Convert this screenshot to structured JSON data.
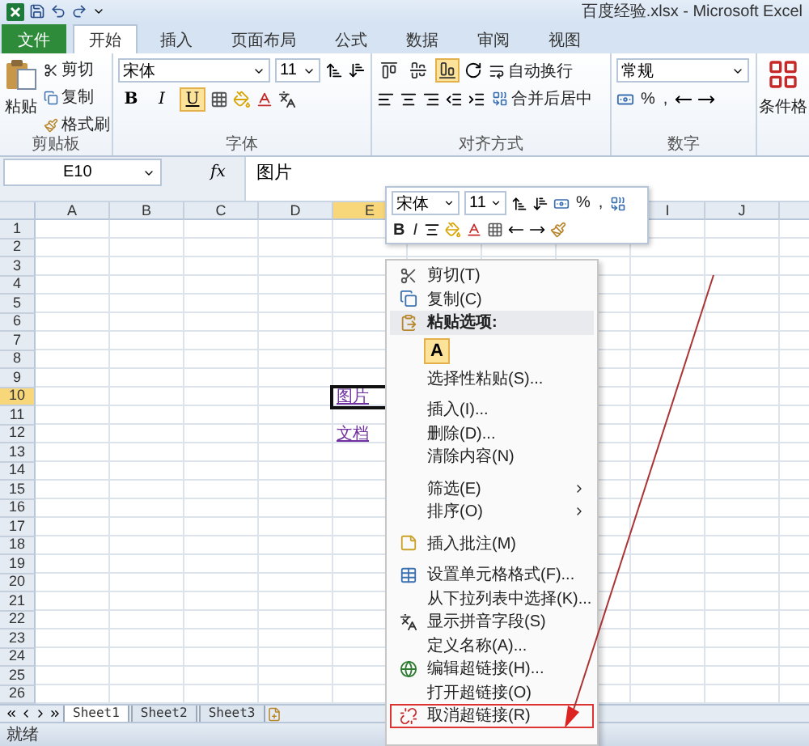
{
  "window": {
    "title": "百度经验.xlsx - Microsoft Excel"
  },
  "ribbon_tabs": [
    {
      "label": "文件",
      "kind": "file",
      "selected": false
    },
    {
      "label": "开始",
      "kind": "tab",
      "selected": true
    },
    {
      "label": "插入",
      "kind": "tab",
      "selected": false
    },
    {
      "label": "页面布局",
      "kind": "tab",
      "selected": false
    },
    {
      "label": "公式",
      "kind": "tab",
      "selected": false
    },
    {
      "label": "数据",
      "kind": "tab",
      "selected": false
    },
    {
      "label": "审阅",
      "kind": "tab",
      "selected": false
    },
    {
      "label": "视图",
      "kind": "tab",
      "selected": false
    }
  ],
  "ribbon": {
    "clipboard": {
      "label": "剪贴板",
      "paste": "粘贴",
      "items": [
        {
          "kind": "cut",
          "label": "剪切"
        },
        {
          "kind": "copy",
          "label": "复制"
        },
        {
          "kind": "brush",
          "label": "格式刷"
        }
      ]
    },
    "font": {
      "label": "字体",
      "font_name": "宋体",
      "font_size": "11",
      "styles": [
        {
          "label": "B",
          "selected": false
        },
        {
          "label": "I",
          "selected": false
        },
        {
          "label": "U",
          "selected": true
        }
      ]
    },
    "alignment": {
      "label": "对齐方式",
      "wrap": "自动换行",
      "merge": "合并后居中",
      "vertical": [
        {
          "selected": false
        },
        {
          "selected": false
        },
        {
          "selected": true
        }
      ]
    },
    "number": {
      "label": "数字",
      "format": "常规",
      "percent": "%",
      "comma": ","
    },
    "styles": {
      "label": "条件格"
    }
  },
  "formula_bar": {
    "name_box": "E10",
    "function_button": "fx",
    "value": "图片"
  },
  "mini_toolbar": {
    "font_name": "宋体",
    "font_size": "11",
    "percent": "%",
    "comma": ",",
    "bold": "B",
    "italic": "I"
  },
  "columns": [
    {
      "kind": "label",
      "label": "A",
      "selected": false
    },
    {
      "kind": "label",
      "label": "B",
      "selected": false
    },
    {
      "kind": "label",
      "label": "C",
      "selected": false
    },
    {
      "kind": "label",
      "label": "D",
      "selected": false
    },
    {
      "kind": "label",
      "label": "E",
      "selected": true
    },
    {
      "kind": "covered"
    },
    {
      "kind": "covered"
    },
    {
      "kind": "covered"
    },
    {
      "kind": "label",
      "label": "I",
      "selected": false
    },
    {
      "kind": "label",
      "label": "J",
      "selected": false
    }
  ],
  "rows": [
    {
      "label": "1",
      "selected": false
    },
    {
      "label": "2",
      "selected": false
    },
    {
      "label": "3",
      "selected": false
    },
    {
      "label": "4",
      "selected": false
    },
    {
      "label": "5",
      "selected": false
    },
    {
      "label": "6",
      "selected": false
    },
    {
      "label": "7",
      "selected": false
    },
    {
      "label": "8",
      "selected": false
    },
    {
      "label": "9",
      "selected": false
    },
    {
      "label": "10",
      "selected": true,
      "column_e": {
        "text": "图片",
        "active": true
      }
    },
    {
      "label": "11",
      "selected": false
    },
    {
      "label": "12",
      "selected": false,
      "column_e": {
        "text": "文档",
        "active": false
      }
    },
    {
      "label": "13",
      "selected": false
    },
    {
      "label": "14",
      "selected": false
    },
    {
      "label": "15",
      "selected": false
    },
    {
      "label": "16",
      "selected": false
    },
    {
      "label": "17",
      "selected": false
    },
    {
      "label": "18",
      "selected": false
    },
    {
      "label": "19",
      "selected": false
    },
    {
      "label": "20",
      "selected": false
    },
    {
      "label": "21",
      "selected": false
    },
    {
      "label": "22",
      "selected": false
    },
    {
      "label": "23",
      "selected": false
    },
    {
      "label": "24",
      "selected": false
    },
    {
      "label": "25",
      "selected": false
    },
    {
      "label": "26",
      "selected": false
    }
  ],
  "context_menu": [
    {
      "kind": "cut",
      "label": "剪切(T)",
      "separator_after": false
    },
    {
      "kind": "copy",
      "label": "复制(C)",
      "separator_after": false
    },
    {
      "kind": "pasteheader",
      "label": "粘贴选项:",
      "separator_after": false
    },
    {
      "kind": "pasteoptions",
      "label": "A"
    },
    {
      "kind": "plain",
      "label": "选择性粘贴(S)...",
      "separator_after": true
    },
    {
      "kind": "plain",
      "label": "插入(I)...",
      "separator_after": false
    },
    {
      "kind": "plain",
      "label": "删除(D)...",
      "separator_after": false
    },
    {
      "kind": "plain",
      "label": "清除内容(N)",
      "separator_after": true
    },
    {
      "kind": "submenu",
      "label": "筛选(E)",
      "separator_after": false
    },
    {
      "kind": "submenu",
      "label": "排序(O)",
      "separator_after": true
    },
    {
      "kind": "comment",
      "label": "插入批注(M)",
      "separator_after": true
    },
    {
      "kind": "format",
      "label": "设置单元格格式(F)...",
      "separator_after": false
    },
    {
      "kind": "plain",
      "label": "从下拉列表中选择(K)...",
      "separator_after": false
    },
    {
      "kind": "phonetic",
      "label": "显示拼音字段(S)",
      "separator_after": false
    },
    {
      "kind": "plain",
      "label": "定义名称(A)...",
      "separator_after": false
    },
    {
      "kind": "link",
      "label": "编辑超链接(H)...",
      "separator_after": false
    },
    {
      "kind": "plain",
      "label": "打开超链接(O)",
      "separator_after": false
    },
    {
      "kind": "unlink",
      "label": "取消超链接(R)",
      "separator_after": false,
      "outlined": true
    }
  ],
  "sheet_tabs": [
    {
      "label": "Sheet1",
      "selected": true
    },
    {
      "label": "Sheet2",
      "selected": false
    },
    {
      "label": "Sheet3",
      "selected": false
    }
  ],
  "status_bar": {
    "text": "就绪"
  },
  "annotation_arrow": true
}
